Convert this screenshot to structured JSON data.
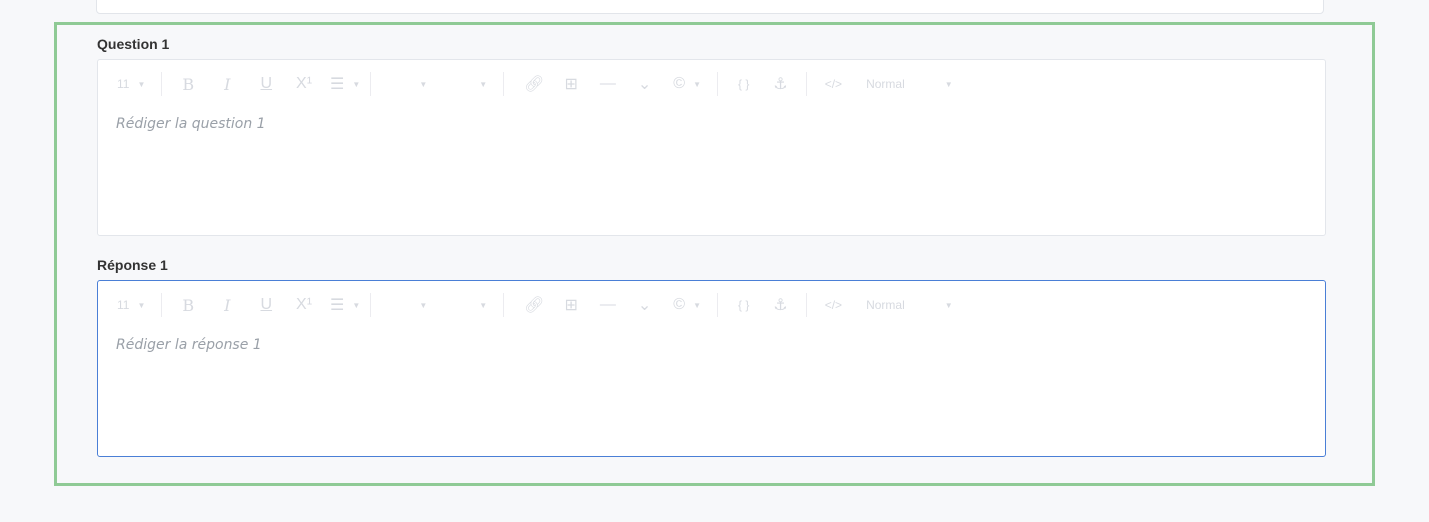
{
  "question": {
    "label": "Question 1",
    "placeholder": "Rédiger la question 1"
  },
  "answer": {
    "label": "Réponse 1",
    "placeholder": "Rédiger la réponse 1"
  },
  "toolbar": {
    "font_size": "11",
    "format": "Normal",
    "bold": "B",
    "italic": "I",
    "underline": "U",
    "superscript": "X¹",
    "code": "{ }",
    "html": "</>",
    "copyright": "©"
  },
  "colors": {
    "frame_border": "#8fca95",
    "focus_border": "#4a7fd6"
  }
}
